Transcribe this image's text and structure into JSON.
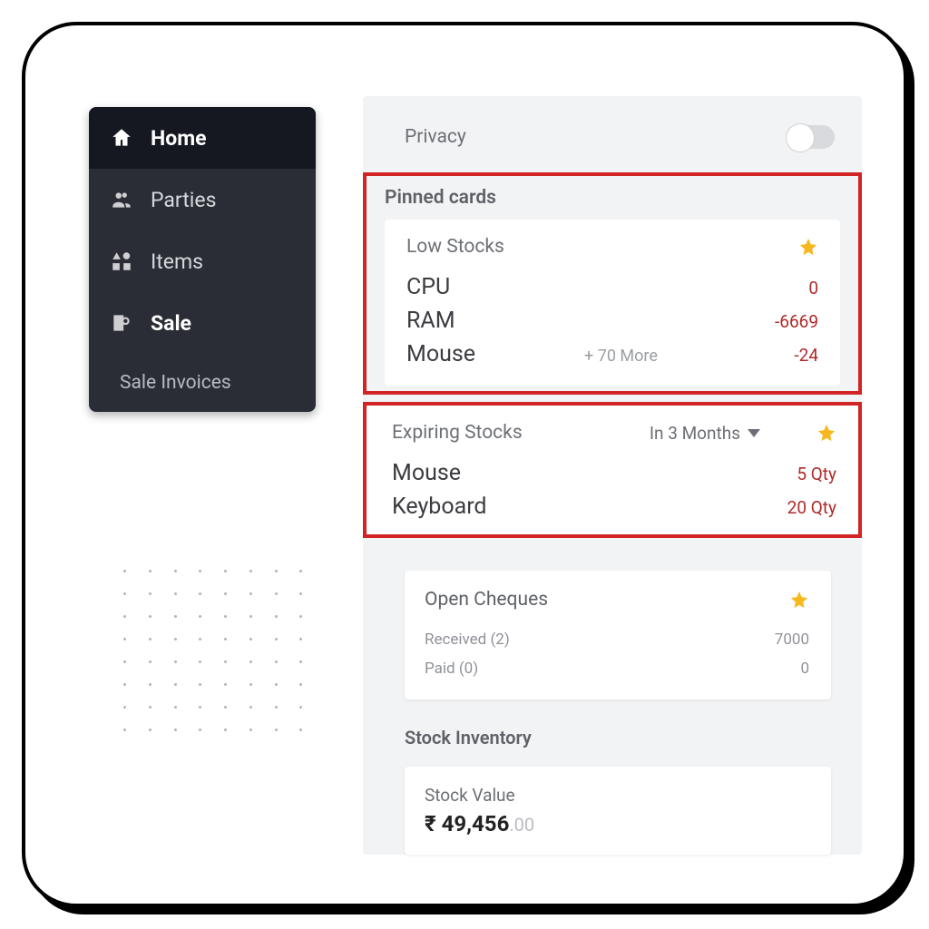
{
  "sidebar": {
    "items": [
      {
        "label": "Home"
      },
      {
        "label": "Parties"
      },
      {
        "label": "Items"
      },
      {
        "label": "Sale"
      },
      {
        "label": "Sale Invoices"
      }
    ]
  },
  "privacy": {
    "label": "Privacy"
  },
  "pinned_cards_title": "Pinned cards",
  "low_stocks": {
    "title": "Low Stocks",
    "items": [
      {
        "name": "CPU",
        "value": "0"
      },
      {
        "name": "RAM",
        "value": "-6669"
      },
      {
        "name": "Mouse",
        "value": "-24"
      }
    ],
    "more": "+ 70 More"
  },
  "expiring_stocks": {
    "title": "Expiring Stocks",
    "filter": "In 3 Months",
    "items": [
      {
        "name": "Mouse",
        "value": "5 Qty"
      },
      {
        "name": "Keyboard",
        "value": "20 Qty"
      }
    ]
  },
  "open_cheques": {
    "title": "Open Cheques",
    "rows": [
      {
        "label": "Received (2)",
        "value": "7000"
      },
      {
        "label": "Paid (0)",
        "value": "0"
      }
    ]
  },
  "stock_inventory": {
    "section_title": "Stock Inventory",
    "card_title": "Stock Value",
    "value": "₹ 49,456",
    "decimal": ".00"
  }
}
